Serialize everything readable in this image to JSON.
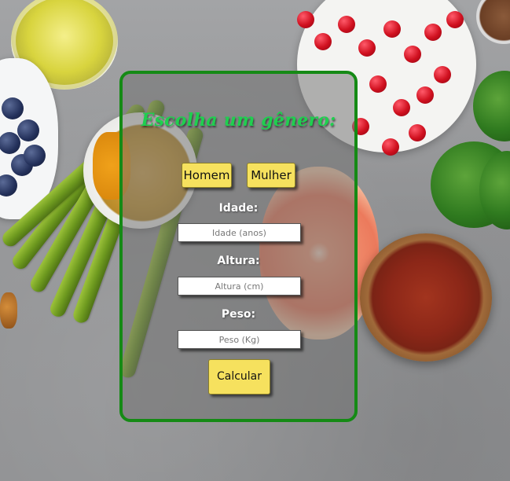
{
  "form": {
    "title": "Escolha um gênero:",
    "gender_buttons": [
      {
        "label": "Homem"
      },
      {
        "label": "Mulher"
      }
    ],
    "fields": {
      "idade": {
        "label": "Idade:",
        "placeholder": "Idade (anos)",
        "value": ""
      },
      "altura": {
        "label": "Altura:",
        "placeholder": "Altura (cm)",
        "value": ""
      },
      "peso": {
        "label": "Peso:",
        "placeholder": "Peso (Kg)",
        "value": ""
      }
    },
    "submit_label": "Calcular"
  },
  "colors": {
    "card_border": "#158a15",
    "title": "#1fcf4f",
    "button": "#f6e15e"
  }
}
